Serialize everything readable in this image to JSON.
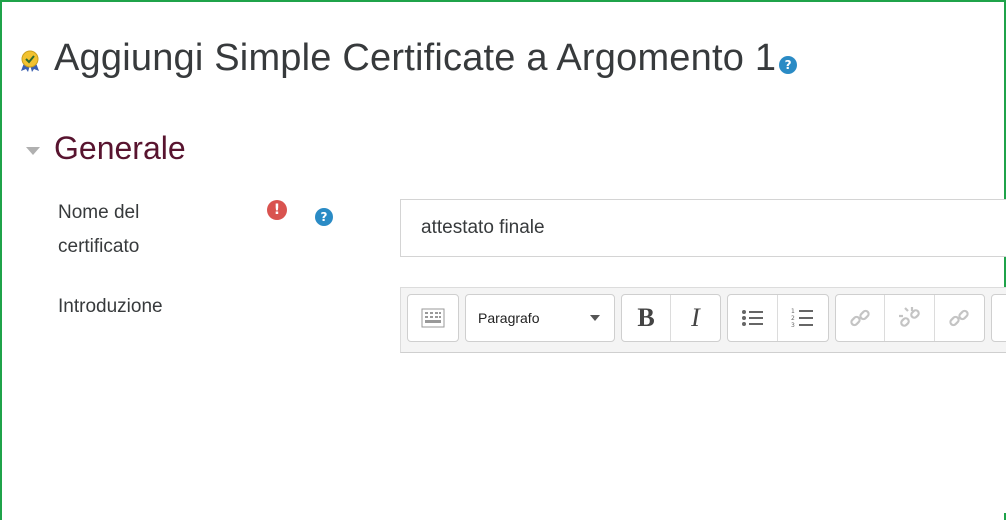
{
  "page": {
    "title": "Aggiungi Simple Certificate a Argomento 1",
    "title_help": "?",
    "title_icon": "certificate-icon"
  },
  "section": {
    "title": "Generale",
    "expanded": true
  },
  "fields": {
    "name": {
      "label": "Nome del certificato",
      "required_icon": "!",
      "help": "?",
      "value": "attestato finale"
    },
    "intro": {
      "label": "Introduzione"
    }
  },
  "toolbar": {
    "format_value": "Paragrafo",
    "bold": "B",
    "italic": "I",
    "buttons": [
      "toolbar-toggle-icon",
      "bold-icon",
      "italic-icon",
      "unordered-list-icon",
      "ordered-list-icon",
      "link-icon",
      "unlink-icon",
      "link-alt-icon",
      "image-icon"
    ]
  },
  "colors": {
    "frame_border": "#1fa34a",
    "section_title": "#58142f",
    "help_icon": "#2a8bc5",
    "required_icon": "#d9534f"
  }
}
